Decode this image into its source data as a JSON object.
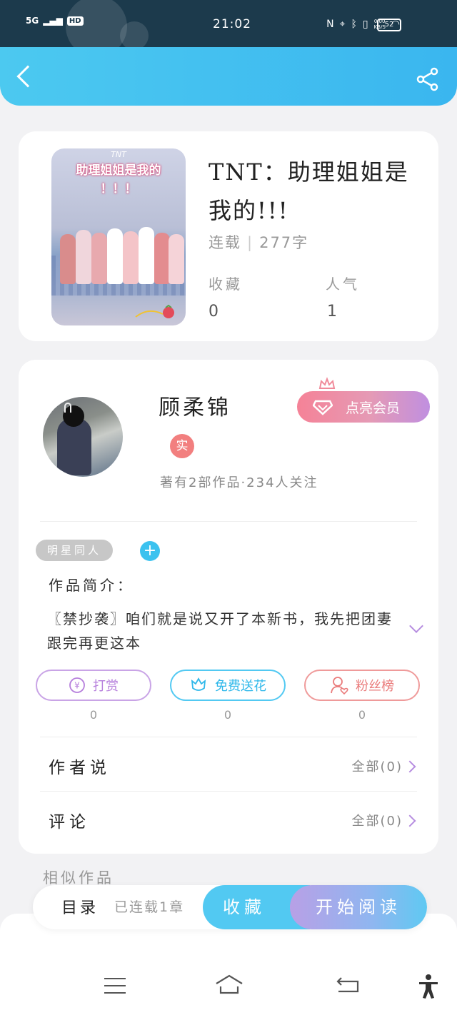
{
  "status_bar": {
    "network": "5G",
    "hd": "HD",
    "time": "21:02",
    "speed_value": "0.00",
    "speed_unit": "KB/S",
    "battery": "52"
  },
  "book": {
    "cover_tnt": "TNT",
    "cover_title": "助理姐姐是我的",
    "cover_exclaim": "！！！",
    "title": "TNT：助理姐姐是我的!!!",
    "status": "连载",
    "word_count": "277字",
    "favorites_label": "收藏",
    "favorites_value": "0",
    "popularity_label": "人气",
    "popularity_value": "1"
  },
  "author": {
    "name": "顾柔锦",
    "verified_badge": "实",
    "works_summary": "著有2部作品·234人关注",
    "vip_button": "点亮会员"
  },
  "tags": [
    "明星同人"
  ],
  "intro": {
    "label": "作品简介：",
    "text": "〖禁抄袭〗咱们就是说又开了本新书，我先把团妻跟完再更这本"
  },
  "actions": {
    "reward": {
      "label": "打赏",
      "count": "0"
    },
    "flower": {
      "label": "免费送花",
      "count": "0"
    },
    "fans": {
      "label": "粉丝榜",
      "count": "0"
    }
  },
  "author_says": {
    "label": "作者说",
    "all": "全部(0)"
  },
  "comments": {
    "label": "评论",
    "all": "全部(0)"
  },
  "similar_label": "相似作品",
  "bottom_bar": {
    "toc_label": "目录",
    "toc_status": "已连载1章",
    "collect_label": "收藏",
    "read_label": "开始阅读"
  },
  "colors": {
    "header": "#3ab6ef",
    "accent_blue": "#52c9f2",
    "accent_purple": "#b68de0",
    "accent_pink": "#f58297"
  }
}
